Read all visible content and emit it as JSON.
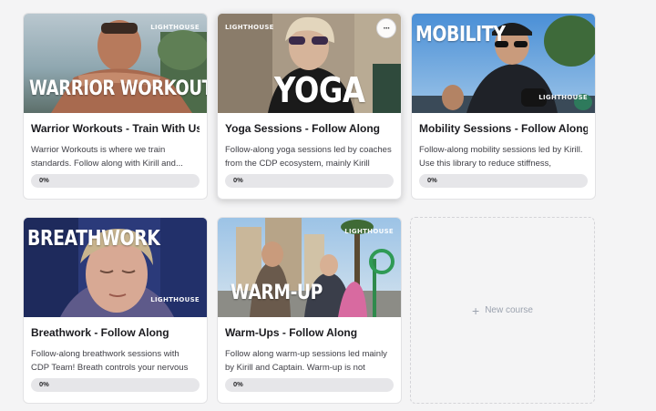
{
  "courses": [
    {
      "title": "Warrior Workouts - Train With Us",
      "description": "Warrior Workouts is where we train standards. Follow along with Kirill and...",
      "progress_label": "0%",
      "progress": 0,
      "thumbnail_text": "WARRIOR WORKOUT",
      "brand": "LIGHTHOUSE"
    },
    {
      "title": "Yoga Sessions - Follow Along",
      "description": "Follow-along yoga sessions led by coaches from the CDP ecosystem, mainly Kirill and...",
      "progress_label": "0%",
      "progress": 0,
      "thumbnail_text": "YOGA",
      "brand": "LIGHTHOUSE",
      "more_icon": "···"
    },
    {
      "title": "Mobility Sessions - Follow Along",
      "description": "Follow-along mobility sessions led by Kirill. Use this library to reduce stiffness, improve...",
      "progress_label": "0%",
      "progress": 0,
      "thumbnail_text": "MOBILITY",
      "brand": "LIGHTHOUSE"
    },
    {
      "title": "Breathwork - Follow Along",
      "description": "Follow-along breathwork sessions with CDP Team! Breath controls your nervous system,...",
      "progress_label": "0%",
      "progress": 0,
      "thumbnail_text": "BREATHWORK",
      "brand": "LIGHTHOUSE"
    },
    {
      "title": "Warm-Ups - Follow Along",
      "description": "Follow along warm-up sessions led mainly by Kirill and Captain. Warm-up is not optional - ...",
      "progress_label": "0%",
      "progress": 0,
      "thumbnail_text": "WARM-UP",
      "brand": "LIGHTHOUSE"
    }
  ],
  "new_course": {
    "label": "New course",
    "icon": "+"
  },
  "colors": {
    "page_bg": "#f4f4f5",
    "card_bg": "#ffffff",
    "progress_track": "#e6e6e9",
    "muted_text": "#9ca3af"
  }
}
